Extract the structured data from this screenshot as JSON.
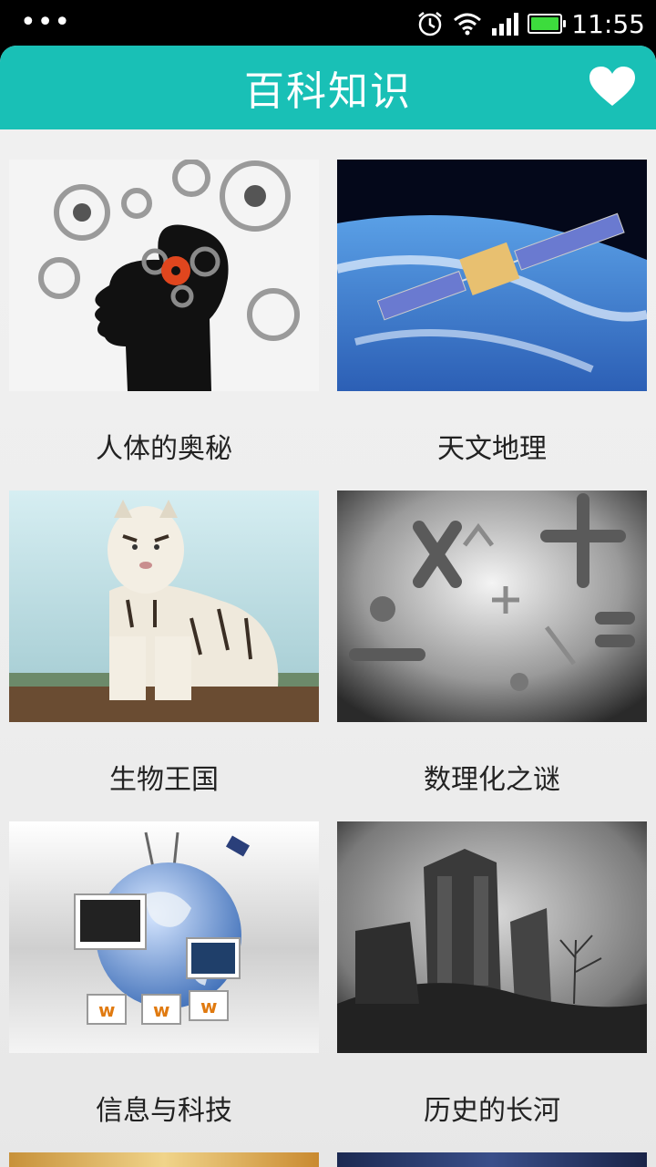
{
  "status_bar": {
    "menu_icon": "more-dots-icon",
    "time": "11:55",
    "icons": [
      "alarm-icon",
      "wifi-icon",
      "signal-icon",
      "battery-icon"
    ]
  },
  "header": {
    "title": "百科知识",
    "favorite_icon": "heart-icon",
    "accent_color": "#19c0b6"
  },
  "categories": [
    {
      "label": "人体的奥秘",
      "image": "human-brain-gears-image"
    },
    {
      "label": "天文地理",
      "image": "satellite-earth-image"
    },
    {
      "label": "生物王国",
      "image": "white-tiger-image"
    },
    {
      "label": "数理化之谜",
      "image": "math-symbols-image"
    },
    {
      "label": "信息与科技",
      "image": "globe-computers-image"
    },
    {
      "label": "历史的长河",
      "image": "ruins-image"
    }
  ]
}
